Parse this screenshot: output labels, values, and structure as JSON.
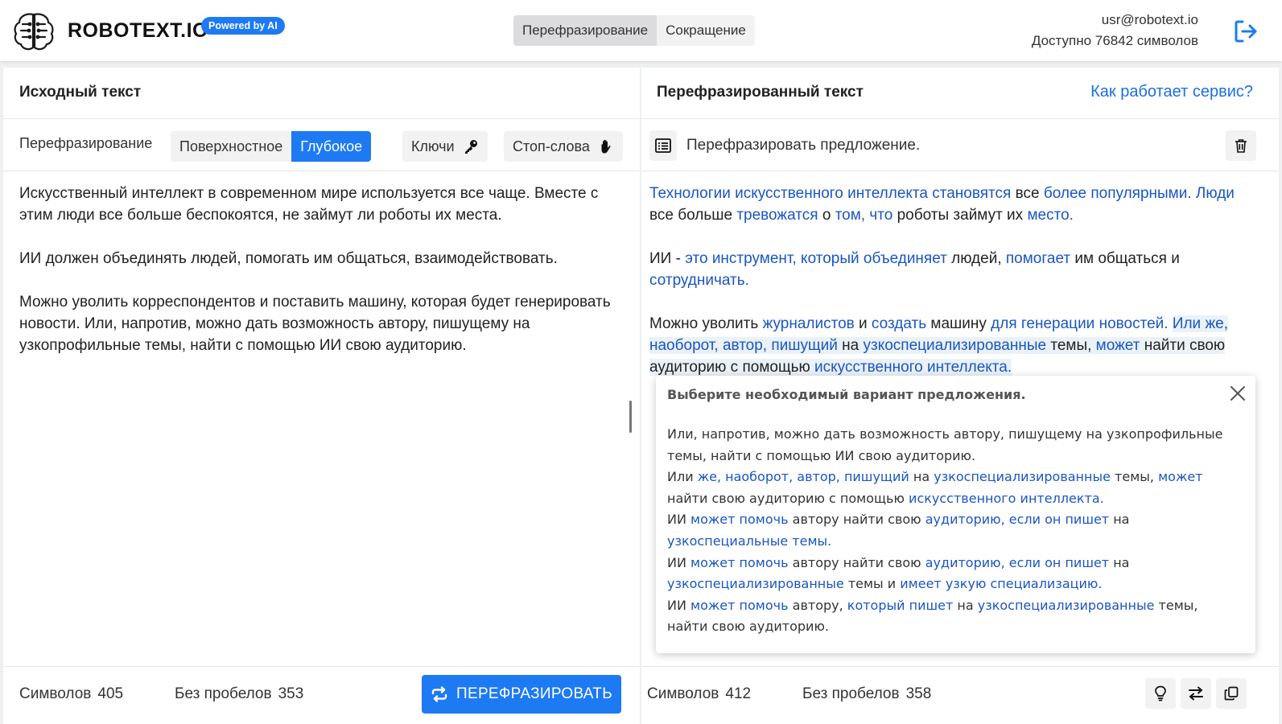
{
  "header": {
    "brand": "ROBOTEXT.IO",
    "badge": "Powered by AI",
    "modes": [
      "Перефразирование",
      "Сокращение"
    ],
    "user_email": "usr@robotext.io",
    "user_chars": "Доступно 76842 символов"
  },
  "colors": {
    "accent": "#1d7af3",
    "link": "#1d6fe0",
    "highlight": "#1a56c2"
  },
  "left": {
    "title": "Исходный текст",
    "mode_label": "Перефразирование",
    "depth_options": [
      "Поверхностное",
      "Глубокое"
    ],
    "depth_selected": "Глубокое",
    "keys_label": "Ключи",
    "stopwords_label": "Стоп-слова",
    "paragraphs": [
      "Искусственный интеллект в современном мире используется все чаще. Вместе с этим люди все больше беспокоятся, не займут ли роботы их места.",
      "ИИ должен объединять людей, помогать им общаться, взаимодействовать.",
      "Можно уволить корреспондентов и поставить машину, которая будет генерировать новости. Или, напротив, можно дать возможность автору, пишущему на узкопрофильные темы, найти с помощью ИИ свою аудиторию."
    ],
    "chars_label": "Символов",
    "chars_value": "405",
    "nospace_label": "Без пробелов",
    "nospace_value": "353",
    "paraphrase_button": "ПЕРЕФРАЗИРОВАТЬ"
  },
  "right": {
    "title": "Перефразированный текст",
    "help_link": "Как работает сервис?",
    "sentence_label": "Перефразировать предложение.",
    "paragraphs": [
      [
        [
          "Технологии искусственного интеллекта становятся",
          1
        ],
        [
          " все ",
          0
        ],
        [
          "более популярными. Люди",
          1
        ],
        [
          " все больше ",
          0
        ],
        [
          "тревожатся",
          1
        ],
        [
          " о ",
          0
        ],
        [
          "том, что",
          1
        ],
        [
          " роботы займут их ",
          0
        ],
        [
          "место.",
          1
        ]
      ],
      [
        [
          "ИИ - ",
          0
        ],
        [
          "это инструмент, который объединяет",
          1
        ],
        [
          " людей, ",
          0
        ],
        [
          "помогает",
          1
        ],
        [
          " им общаться и ",
          0
        ],
        [
          "сотрудничать.",
          1
        ]
      ],
      [
        [
          "Можно уволить ",
          0
        ],
        [
          "журналистов",
          1
        ],
        [
          " и ",
          0
        ],
        [
          "создать",
          1
        ],
        [
          " машину ",
          0
        ],
        [
          "для генерации новостей.",
          1
        ],
        [
          " ",
          0
        ],
        [
          "Или же, наоборот, автор, пишущий",
          1,
          1
        ],
        [
          " на ",
          0,
          1
        ],
        [
          "узкоспециализированные",
          1,
          1
        ],
        [
          " темы, ",
          0,
          1
        ],
        [
          "может",
          1,
          1
        ],
        [
          " найти свою аудиторию с помощью ",
          0,
          1
        ],
        [
          "искусственного интеллекта.",
          1,
          1
        ]
      ]
    ],
    "popup": {
      "title": "Выберите необходимый вариант предложения.",
      "options": [
        [
          [
            "Или, напротив, можно дать возможность автору, пишущему на узкопрофильные темы, найти с помощью ИИ свою аудиторию.",
            0
          ]
        ],
        [
          [
            "Или ",
            0
          ],
          [
            "же, наоборот, автор, пишущий",
            1
          ],
          [
            " на ",
            0
          ],
          [
            "узкоспециализированные",
            1
          ],
          [
            " темы, ",
            0
          ],
          [
            "может",
            1
          ],
          [
            " найти свою аудиторию с помощью ",
            0
          ],
          [
            "искусственного интеллекта.",
            1
          ]
        ],
        [
          [
            "ИИ ",
            0
          ],
          [
            "может помочь",
            1
          ],
          [
            " автору найти свою ",
            0
          ],
          [
            "аудиторию, если он пишет",
            1
          ],
          [
            " на ",
            0
          ],
          [
            "узкоспециальные темы.",
            1
          ]
        ],
        [
          [
            "ИИ ",
            0
          ],
          [
            "может помочь",
            1
          ],
          [
            " автору найти свою ",
            0
          ],
          [
            "аудиторию, если он пишет",
            1
          ],
          [
            " на ",
            0
          ],
          [
            "узкоспециализированные",
            1
          ],
          [
            " темы и ",
            0
          ],
          [
            "имеет узкую специализацию.",
            1
          ]
        ],
        [
          [
            "ИИ ",
            0
          ],
          [
            "может помочь",
            1
          ],
          [
            " автору, ",
            0
          ],
          [
            "который пишет",
            1
          ],
          [
            " на ",
            0
          ],
          [
            "узкоспециализированные",
            1
          ],
          [
            " темы, найти свою аудиторию.",
            0
          ]
        ]
      ]
    },
    "chars_label": "Символов",
    "chars_value": "412",
    "nospace_label": "Без пробелов",
    "nospace_value": "358"
  }
}
